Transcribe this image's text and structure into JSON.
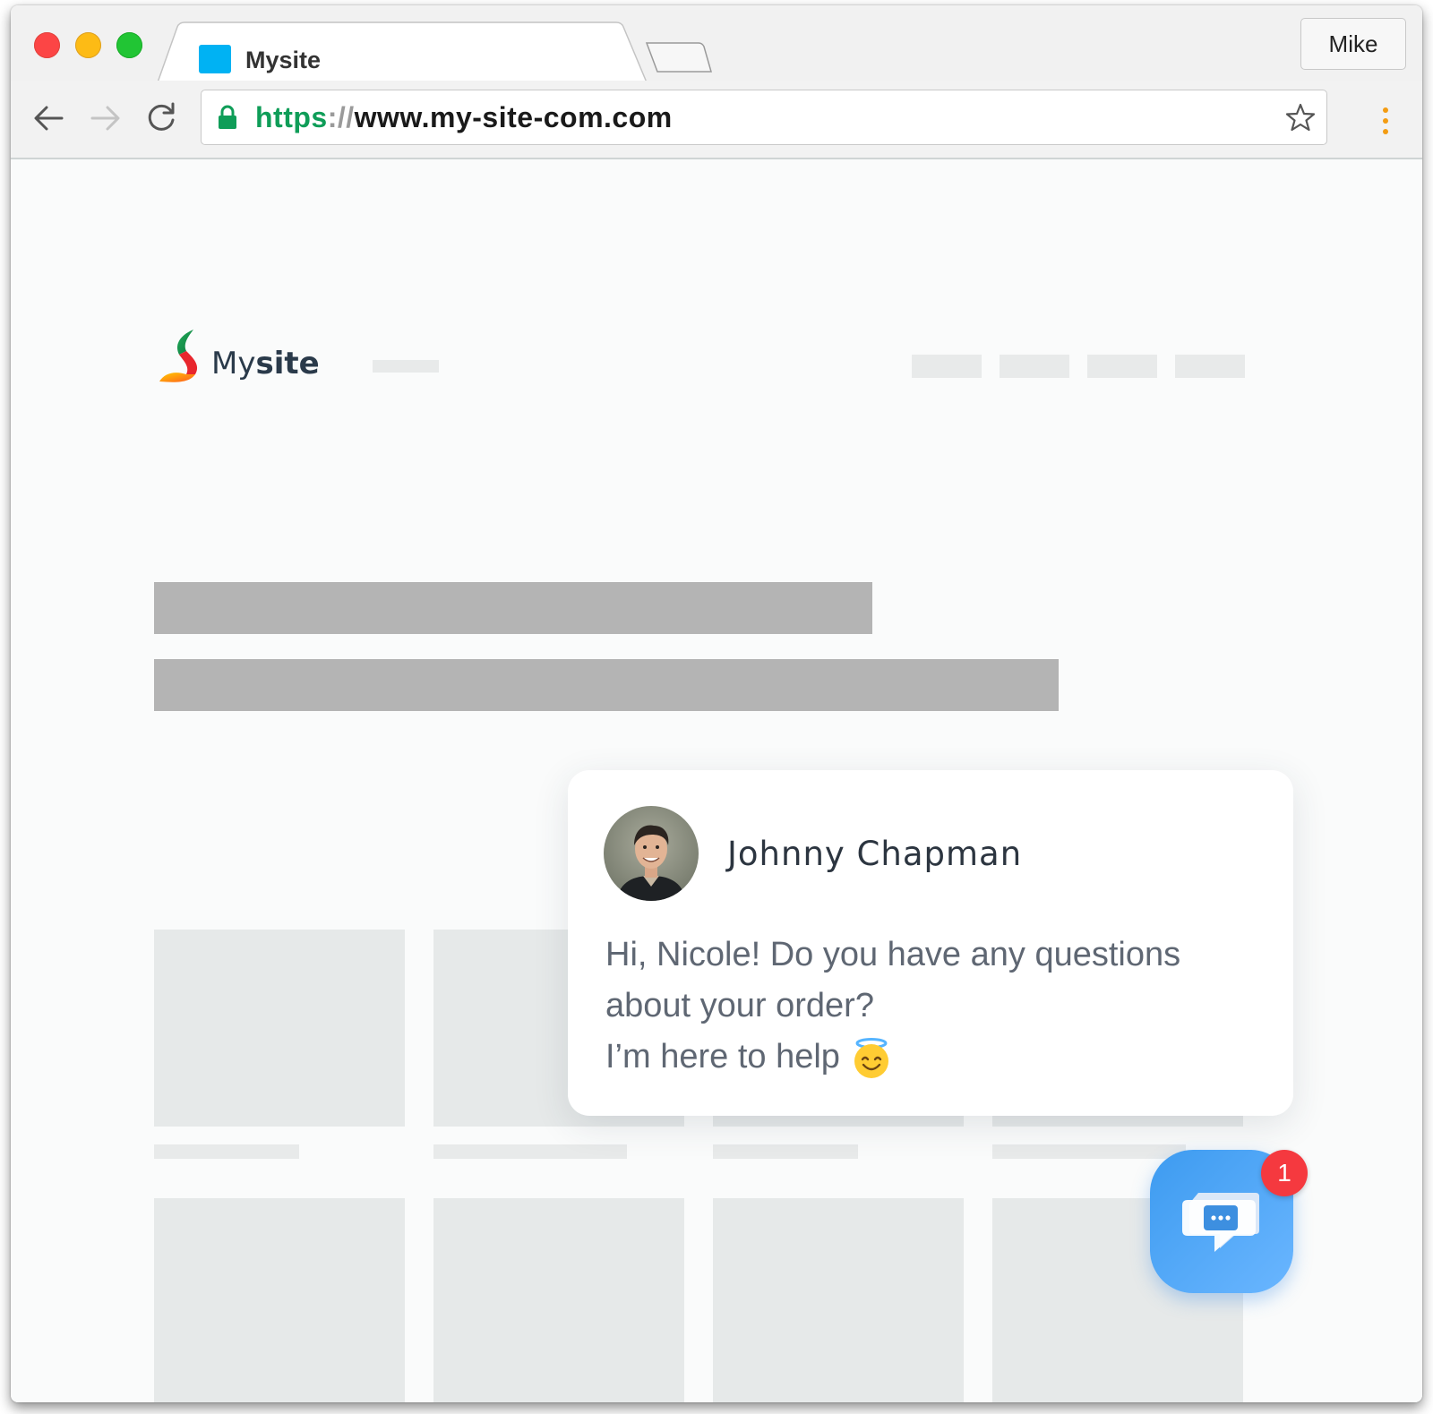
{
  "browser": {
    "tab_title": "Mysite",
    "profile_name": "Mike",
    "url": {
      "scheme": "https",
      "separator": "://",
      "host": "www.my-site-com.com"
    },
    "colors": {
      "close": "#fc4545",
      "minimize": "#fdbb15",
      "maximize": "#21c534",
      "favicon": "#00b2f3",
      "secure": "#0f9d58",
      "menu_dots": "#f39c12"
    },
    "icons": [
      "back-icon",
      "forward-icon",
      "reload-icon",
      "lock-icon",
      "star-icon",
      "kebab-menu-icon"
    ]
  },
  "site": {
    "logo_prefix": "My",
    "logo_suffix": "site"
  },
  "chat": {
    "agent_name": "Johnny Chapman",
    "message_lines": [
      "Hi, Nicole! Do you have any questions",
      "about your order?",
      "I’m here to help"
    ],
    "emoji": "smiling-face-with-halo",
    "unread_count": "1",
    "launcher_color": "#3d9bf0",
    "badge_color": "#f5393f"
  }
}
